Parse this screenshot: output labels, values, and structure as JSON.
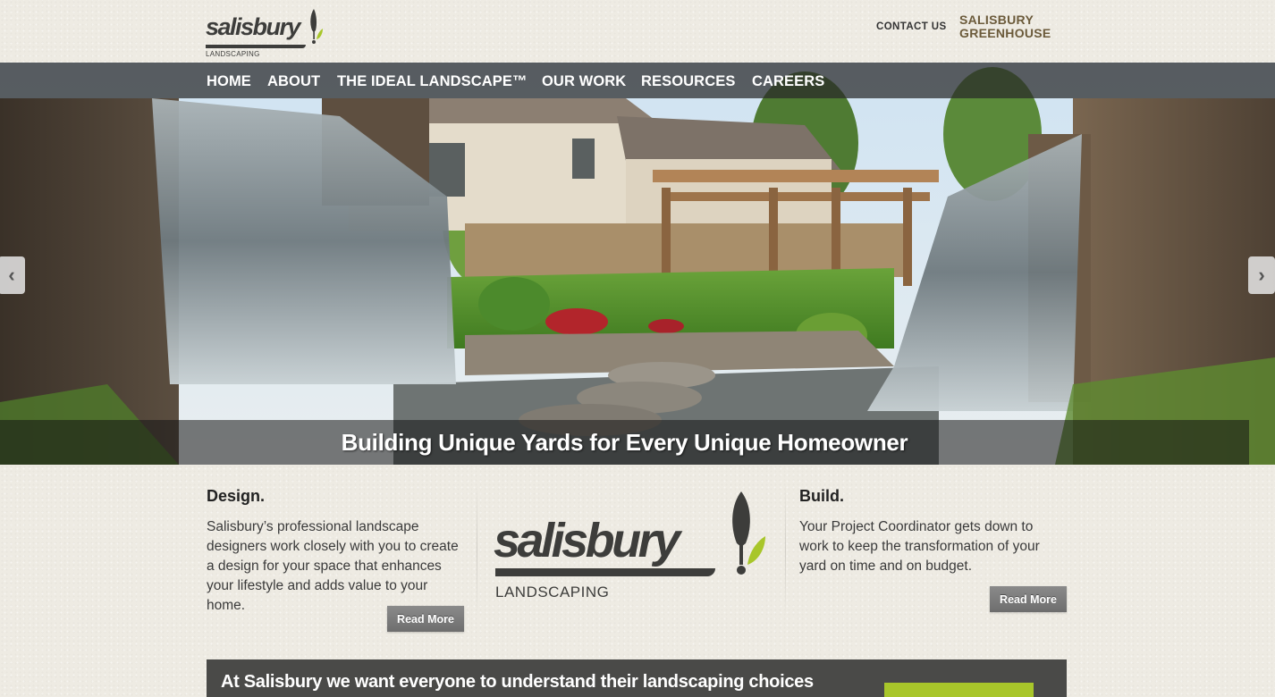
{
  "header": {
    "logo_word": "salisbury",
    "logo_sub": "LANDSCAPING",
    "contact": "CONTACT US",
    "greenhouse": "SALISBURY GREENHOUSE"
  },
  "nav": {
    "items": [
      "HOME",
      "ABOUT",
      "THE IDEAL LANDSCAPE™",
      "OUR WORK",
      "RESOURCES",
      "CAREERS"
    ]
  },
  "hero": {
    "caption": "Building Unique Yards for Every Unique Homeowner",
    "prev_icon": "chevron-left-icon",
    "next_icon": "chevron-right-icon"
  },
  "design": {
    "title": "Design.",
    "text": "Salisbury’s professional landscape designers work closely with you to create a design for your space that enhances your lifestyle and adds value to your home.",
    "button": "Read More"
  },
  "center_logo": {
    "word": "salisbury",
    "sub": "LANDSCAPING"
  },
  "build": {
    "title": "Build.",
    "text": "Your Project Coordinator gets down to work to keep the transformation of your yard on time and on budget.",
    "button": "Read More"
  },
  "banner": {
    "text": "At Salisbury we want everyone to understand their landscaping choices"
  },
  "colors": {
    "accent_green": "#a8c62a",
    "greenhouse_brown": "#6b5a3a",
    "nav_bg": "#282828",
    "banner_bg": "#4a4a48"
  }
}
